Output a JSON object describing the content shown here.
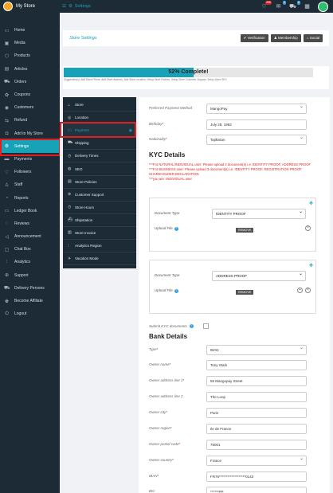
{
  "topbar": {
    "store_name": "My Store",
    "nav_label": "Settings",
    "badges": {
      "notifications": "205",
      "messages": "0",
      "cart": "0"
    }
  },
  "sidebar": {
    "items": [
      {
        "label": "Home",
        "icon": "monitor-icon"
      },
      {
        "label": "Media",
        "icon": "image-icon"
      },
      {
        "label": "Products",
        "icon": "cube-icon"
      },
      {
        "label": "Articles",
        "icon": "file-icon"
      },
      {
        "label": "Orders",
        "icon": "cart-icon"
      },
      {
        "label": "Coupons",
        "icon": "gift-icon"
      },
      {
        "label": "Customers",
        "icon": "user-circle-icon"
      },
      {
        "label": "Refund",
        "icon": "refund-icon"
      },
      {
        "label": "Add to My Store",
        "icon": "bag-icon"
      },
      {
        "label": "Settings",
        "icon": "cogs-icon"
      },
      {
        "label": "Payments",
        "icon": "card-icon"
      },
      {
        "label": "Followers",
        "icon": "heart-icon"
      },
      {
        "label": "Staff",
        "icon": "user-icon"
      },
      {
        "label": "Reports",
        "icon": "pie-chart-icon"
      },
      {
        "label": "Ledger Book",
        "icon": "money-icon"
      },
      {
        "label": "Reviews",
        "icon": "comment-icon"
      },
      {
        "label": "Announcement",
        "icon": "megaphone-icon"
      },
      {
        "label": "Chat Box",
        "icon": "chat-icon"
      },
      {
        "label": "Analytics",
        "icon": "chart-icon"
      },
      {
        "label": "Support",
        "icon": "lifebuoy-icon"
      },
      {
        "label": "Delivery Persons",
        "icon": "truck-icon"
      },
      {
        "label": "Become Affiliate",
        "icon": "group-icon"
      },
      {
        "label": "Logout",
        "icon": "power-icon"
      }
    ]
  },
  "main": {
    "title": "Store Settings",
    "buttons": {
      "verification": "Verification",
      "membership": "Membership",
      "social": "Social"
    },
    "progress": {
      "percent": 52,
      "label": "52% Complete!"
    },
    "suggestion": "Suggestion(s): Add Store Phone, Add Store Address, Add Store Location, Setup Store Policies, Setup Store Customer Support, Setup Store SEO"
  },
  "tabs": [
    {
      "label": "Store",
      "icon": "store-icon"
    },
    {
      "label": "Location",
      "icon": "location-icon"
    },
    {
      "label": "Payment",
      "icon": "card-icon"
    },
    {
      "label": "Shipping",
      "icon": "truck-icon"
    },
    {
      "label": "Delivery Times",
      "icon": "clock-icon"
    },
    {
      "label": "SEO",
      "icon": "globe-icon"
    },
    {
      "label": "Store Policies",
      "icon": "policy-icon"
    },
    {
      "label": "Customer Support",
      "icon": "support-icon"
    },
    {
      "label": "Store Hours",
      "icon": "clock-icon"
    },
    {
      "label": "Shipstation",
      "icon": "ship-icon"
    },
    {
      "label": "Store Invoice",
      "icon": "invoice-icon"
    },
    {
      "label": "Analytics Region",
      "icon": "analytics-icon"
    },
    {
      "label": "Vacation Mode",
      "icon": "vacation-icon"
    }
  ],
  "form": {
    "preferred_payment": {
      "label": "Preferred Payment Method",
      "value": "MangoPay"
    },
    "birthday": {
      "label": "Birthday",
      "value": "July 28, 1992"
    },
    "nationality": {
      "label": "Nationality",
      "value": "Tajikistan"
    },
    "kyc_title": "KYC Details",
    "kyc_note1": "***For NATURAL/INDIVIDUAL user: Please upload 2 document(s) i.e. IDENTITY PROOF, ADDRESS PROOF",
    "kyc_note2": "***For BUSINESS user: Please upload 3 document(s) i.e. IDENTITY PROOF, REGISTRATION PROOF, SHAREHOLDER DECLARATION",
    "kyc_note3": "***you are: INDIVIDUAL user",
    "doc1": {
      "type_label": "Document Type",
      "type_value": "IDENTITY PROOF",
      "upload_label": "Upload File",
      "remove": "REMOVE"
    },
    "doc2": {
      "type_label": "Document Type",
      "type_value": "ADDRESS PROOF",
      "upload_label": "Upload File",
      "remove": "REMOVE"
    },
    "submit_kyc": "Submit KYC documents",
    "bank_title": "Bank Details",
    "type": {
      "label": "Type",
      "value": "IBAN"
    },
    "owner_name": {
      "label": "Owner name",
      "value": "Tony Stark"
    },
    "owner_addr1": {
      "label": "Owner address line 1",
      "value": "55 Mangopay Street"
    },
    "owner_addr2": {
      "label": "Owner address line 2",
      "value": "The Loop"
    },
    "owner_city": {
      "label": "Owner city",
      "value": "Paris"
    },
    "owner_region": {
      "label": "Owner region",
      "value": "Ile de France"
    },
    "owner_postal": {
      "label": "Owner postal code",
      "value": "75001"
    },
    "owner_country": {
      "label": "Owner country",
      "value": "France"
    },
    "iban": {
      "label": "IBAN",
      "value": "FR76*******************0143"
    },
    "bic": {
      "label": "BIC",
      "value": "******PP"
    }
  },
  "colors": {
    "accent": "#17a2b8",
    "sidebar_bg": "#1d2b36",
    "highlight": "#e02020"
  }
}
